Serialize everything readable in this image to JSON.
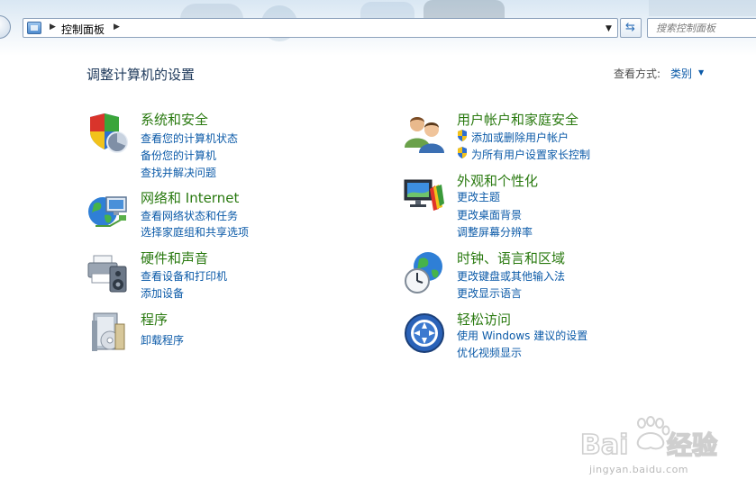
{
  "address": {
    "breadcrumb": "控制面板",
    "search_placeholder": "搜索控制面板"
  },
  "header": {
    "title": "调整计算机的设置",
    "view_by_label": "查看方式:",
    "view_by_value": "类别"
  },
  "categories": [
    {
      "title": "系统和安全",
      "icon": "shield-chart-icon",
      "links": [
        "查看您的计算机状态",
        "备份您的计算机",
        "查找并解决问题"
      ]
    },
    {
      "title": "网络和 Internet",
      "icon": "globe-network-icon",
      "links": [
        "查看网络状态和任务",
        "选择家庭组和共享选项"
      ]
    },
    {
      "title": "硬件和声音",
      "icon": "printer-speaker-icon",
      "links": [
        "查看设备和打印机",
        "添加设备"
      ]
    },
    {
      "title": "程序",
      "icon": "programs-box-icon",
      "links": [
        "卸载程序"
      ]
    },
    {
      "title": "用户帐户和家庭安全",
      "icon": "users-icon",
      "links": [
        "添加或删除用户帐户",
        "为所有用户设置家长控制"
      ]
    },
    {
      "title": "外观和个性化",
      "icon": "monitor-palette-icon",
      "links": [
        "更改主题",
        "更改桌面背景",
        "调整屏幕分辨率"
      ]
    },
    {
      "title": "时钟、语言和区域",
      "icon": "clock-globe-icon",
      "links": [
        "更改键盘或其他输入法",
        "更改显示语言"
      ]
    },
    {
      "title": "轻松访问",
      "icon": "ease-of-access-icon",
      "links": [
        "使用 Windows 建议的设置",
        "优化视频显示"
      ]
    }
  ],
  "watermark": {
    "logo_text": "Bai经验",
    "url": "jingyan.baidu.com"
  },
  "colors": {
    "category_title": "#2a7a10",
    "link": "#0b5aa8",
    "page_title": "#1e395b"
  }
}
